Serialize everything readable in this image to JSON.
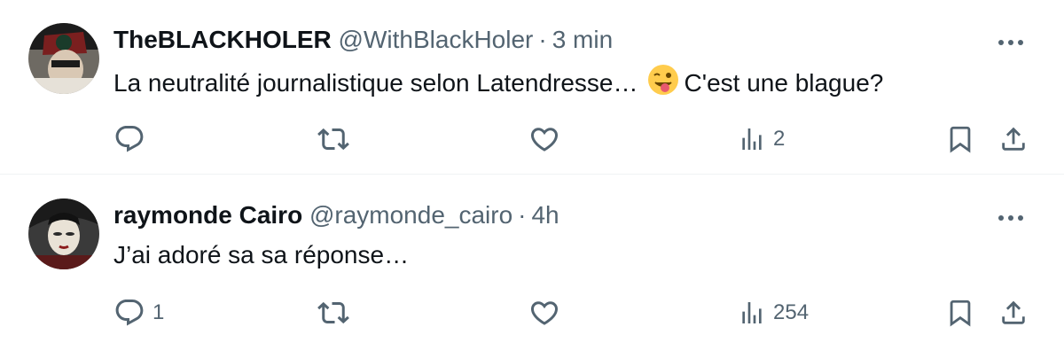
{
  "tweets": [
    {
      "name": "TheBLACKHOLER",
      "handle": "@WithBlackHoler",
      "separator": "·",
      "time": "3 min",
      "text_before_emoji": "La neutralité journalistique selon Latendresse…",
      "emoji": "winking-face-with-tongue",
      "text_after_emoji": "C'est une blague?",
      "reply_count": "",
      "views_count": "2",
      "avatar": "avatar-theblackholer"
    },
    {
      "name": "raymonde Cairo",
      "handle": "@raymonde_cairo",
      "separator": "·",
      "time": "4h",
      "text": "J’ai adoré sa sa réponse…",
      "reply_count": "1",
      "views_count": "254",
      "avatar": "avatar-raymonde-cairo"
    }
  ],
  "icons": {
    "reply": "reply-icon",
    "retweet": "retweet-icon",
    "like": "heart-icon",
    "views": "views-icon",
    "bookmark": "bookmark-icon",
    "share": "share-icon",
    "more": "more-icon"
  },
  "colors": {
    "text_primary": "#0f1419",
    "text_secondary": "#536471",
    "divider": "#eff3f4"
  }
}
